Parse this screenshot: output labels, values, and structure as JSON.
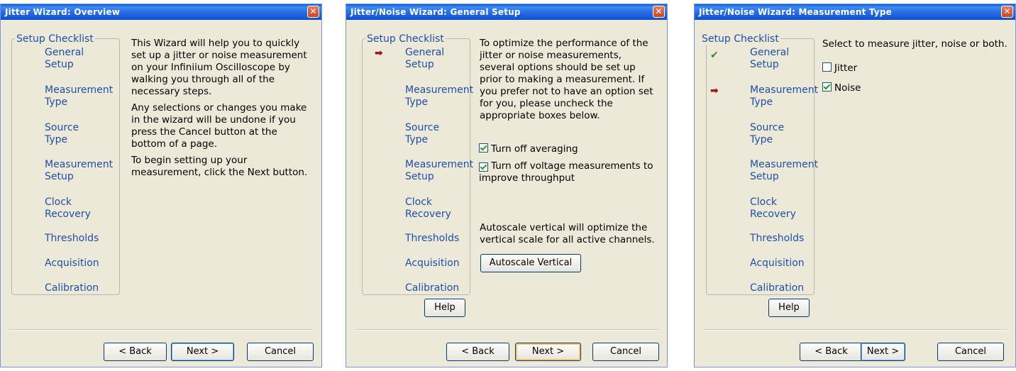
{
  "dialog1": {
    "title": "Jitter Wizard: Overview",
    "close": "✕",
    "checklist_title": "Setup Checklist",
    "steps": [
      "General Setup",
      "Measurement Type",
      "Source Type",
      "Measurement Setup",
      "Clock Recovery",
      "Thresholds",
      "Acquisition",
      "Calibration"
    ],
    "paragraphs": [
      "This Wizard will help you to quickly set up a jitter or noise measurement on your Infiniium Oscilloscope by walking you through all of the necessary steps.",
      "Any selections or changes you make in the wizard will be undone if you press the Cancel button at the bottom of a page.",
      "To begin setting up your measurement, click the Next button."
    ],
    "back": "< Back",
    "next": "Next >",
    "cancel": "Cancel"
  },
  "dialog2": {
    "title": "Jitter/Noise Wizard: General Setup",
    "close": "✕",
    "checklist_title": "Setup Checklist",
    "steps": [
      "General Setup",
      "Measurement Type",
      "Source Type",
      "Measurement Setup",
      "Clock Recovery",
      "Thresholds",
      "Acquisition",
      "Calibration"
    ],
    "current_marker": "➡",
    "intro": "To optimize the performance of the jitter or noise measurements, several options should be set up prior to making a measurement. If you prefer not to have an option set for you, please uncheck the appropriate boxes below.",
    "option1": "Turn off averaging",
    "option1_checked": true,
    "option2": "Turn off voltage measurements to improve throughput",
    "option2_checked": true,
    "autoscale_text": "Autoscale vertical will optimize the vertical scale for all active channels.",
    "autoscale_button": "Autoscale Vertical",
    "help": "Help",
    "back": "< Back",
    "next": "Next >",
    "cancel": "Cancel"
  },
  "dialog3": {
    "title": "Jitter/Noise Wizard: Measurement Type",
    "close": "✕",
    "checklist_title": "Setup Checklist",
    "steps": [
      "General Setup",
      "Measurement Type",
      "Source Type",
      "Measurement Setup",
      "Clock Recovery",
      "Thresholds",
      "Acquisition",
      "Calibration"
    ],
    "done_marker": "✔",
    "current_marker": "➡",
    "prompt": "Select to measure jitter, noise or both.",
    "jitter_label": "Jitter",
    "jitter_checked": false,
    "noise_label": "Noise",
    "noise_checked": true,
    "help": "Help",
    "back": "< Back",
    "next": "Next >",
    "cancel": "Cancel"
  }
}
